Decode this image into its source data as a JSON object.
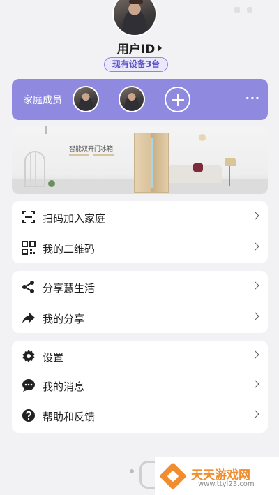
{
  "status_bar": {
    "left_text": ""
  },
  "user": {
    "id_label": "用户ID",
    "devices_pill": "现有设备3台"
  },
  "family": {
    "label": "家庭成员",
    "members": [
      "member-1",
      "member-2"
    ],
    "add_icon": "plus-icon",
    "more_icon": "more-dots-icon",
    "more_text": "···"
  },
  "banner": {
    "headline": "智能双开门冰箱"
  },
  "menu_groups": [
    {
      "items": [
        {
          "label": "扫码加入家庭",
          "icon": "scan-icon"
        },
        {
          "label": "我的二维码",
          "icon": "qrcode-icon"
        }
      ]
    },
    {
      "items": [
        {
          "label": "分享慧生活",
          "icon": "share-icon"
        },
        {
          "label": "我的分享",
          "icon": "forward-icon"
        }
      ]
    },
    {
      "items": [
        {
          "label": "设置",
          "icon": "gear-icon"
        },
        {
          "label": "我的消息",
          "icon": "message-icon"
        },
        {
          "label": "帮助和反馈",
          "icon": "help-icon"
        }
      ]
    }
  ],
  "watermark": {
    "name": "天天游戏网",
    "url": "www.ttyl23.com"
  },
  "colors": {
    "accent": "#8f8ae0",
    "pill_text": "#5a52c4",
    "watermark": "#f08d2e",
    "background": "#f2f2f4"
  }
}
